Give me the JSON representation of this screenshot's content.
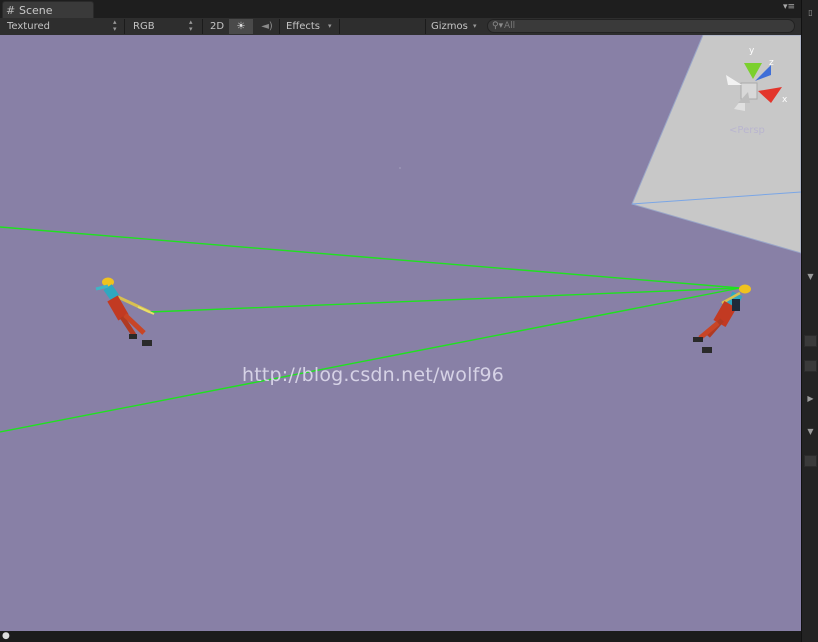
{
  "tab": {
    "title": "Scene",
    "icon": "scene-grid-icon"
  },
  "tab_menu_icon": "panel-menu-icon",
  "toolbar": {
    "draw_mode": "Textured",
    "render_mode": "RGB",
    "toggle_2d": "2D",
    "lighting_icon": "sun-icon",
    "audio_icon": "speaker-icon",
    "effects": "Effects",
    "gizmos": "Gizmos",
    "search_placeholder": "All",
    "search_icon": "search-icon"
  },
  "gizmo": {
    "y": "y",
    "z": "z",
    "x": "x",
    "projection": "Persp"
  },
  "watermark": "http://blog.csdn.net/wolf96",
  "colors": {
    "viewport_bg": "#8880a6",
    "ray": "#1fe21f",
    "plane": "#c8c8c8",
    "axis_x": "#e3352b",
    "axis_y": "#7bd02e",
    "axis_z": "#3f6fd8"
  },
  "statusbar": {
    "icon": "info-icon"
  }
}
